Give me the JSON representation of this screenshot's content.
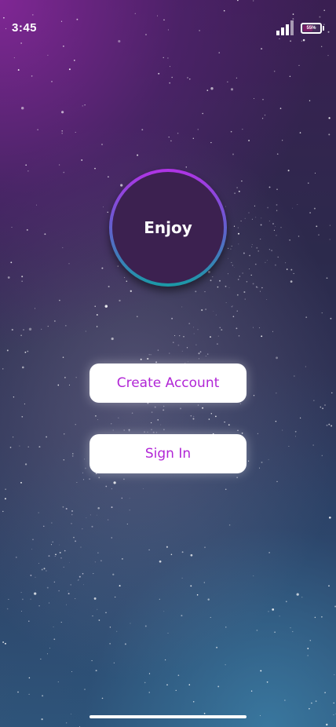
{
  "status_bar": {
    "time": "3:45",
    "battery_label": "55%",
    "battery_level": 0.55,
    "signal_bars_active": 3,
    "signal_bars_total": 4
  },
  "logo": {
    "text": "Enjoy",
    "ring_colors": [
      "#b133e6",
      "#6a5ad1",
      "#1a9aa6"
    ]
  },
  "buttons": {
    "create_account": "Create Account",
    "sign_in": "Sign In"
  },
  "theme": {
    "accent": "#b126d6",
    "button_bg": "#ffffff"
  },
  "background": "night-sky-stars"
}
